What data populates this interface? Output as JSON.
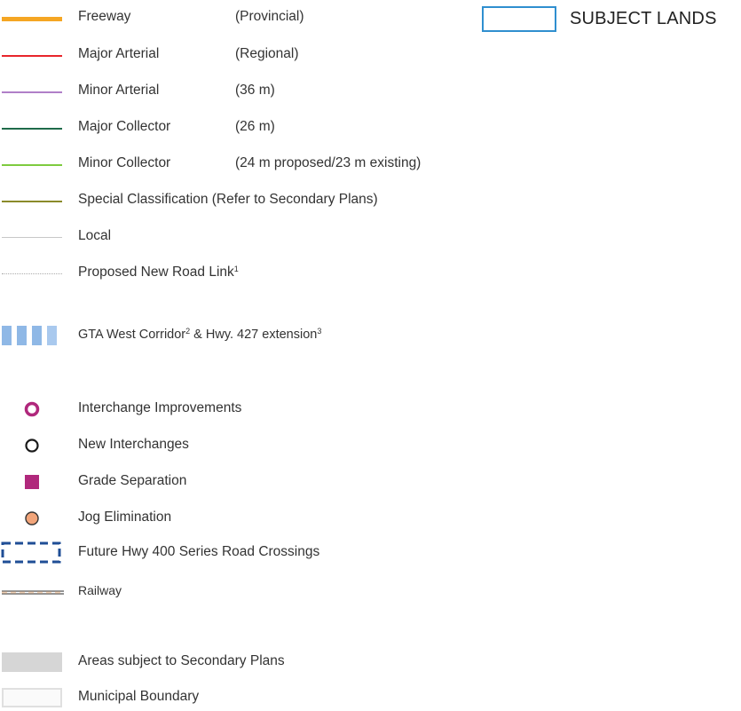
{
  "subject": {
    "label": "SUBJECT LANDS",
    "color": "#2f8fcf"
  },
  "roads": [
    {
      "label": "Freeway",
      "desc": "(Provincial)",
      "color": "#f5a623",
      "style": "thick"
    },
    {
      "label": "Major Arterial",
      "desc": "(Regional)",
      "color": "#e8262c",
      "style": "solid"
    },
    {
      "label": "Minor Arterial",
      "desc": "(36 m)",
      "color": "#b07fc8",
      "style": "solid"
    },
    {
      "label": "Major Collector",
      "desc": "(26 m)",
      "color": "#1f6b4a",
      "style": "solid"
    },
    {
      "label": "Minor Collector",
      "desc": "(24 m proposed/23 m existing)",
      "color": "#7ecb3f",
      "style": "solid"
    },
    {
      "label": "Special Classification (Refer to Secondary Plans)",
      "desc": "",
      "color": "#8a8a2a",
      "style": "solid"
    },
    {
      "label": "Local",
      "desc": "",
      "color": "#c8c8c8",
      "style": "thin"
    },
    {
      "label": "Proposed New Road Link",
      "sup": "1",
      "desc": "",
      "color": "#c8c8c8",
      "style": "dotted"
    }
  ],
  "corridor": {
    "label_a": "GTA West Corridor",
    "sup_a": "2",
    "label_b": " & Hwy. 427 extension",
    "sup_b": "3",
    "color": "#8fb8e6"
  },
  "points": [
    {
      "label": "Interchange Improvements",
      "icon": "ring-magenta-icon",
      "color": "#b0287c"
    },
    {
      "label": "New Interchanges",
      "icon": "ring-black-icon",
      "color": "#1a1a1a"
    },
    {
      "label": "Grade Separation",
      "icon": "square-magenta-icon",
      "color": "#b0287c"
    },
    {
      "label": "Jog Elimination",
      "icon": "circle-orange-icon",
      "color": "#f2a57a"
    }
  ],
  "crossings": {
    "label": "Future Hwy 400 Series Road Crossings",
    "color": "#1f4e96"
  },
  "railway": {
    "label": "Railway",
    "color": "#555555"
  },
  "areas": [
    {
      "label": "Areas subject to Secondary Plans",
      "color": "#d6d6d6"
    },
    {
      "label": "Municipal Boundary",
      "color": "#e6e6e6"
    }
  ]
}
